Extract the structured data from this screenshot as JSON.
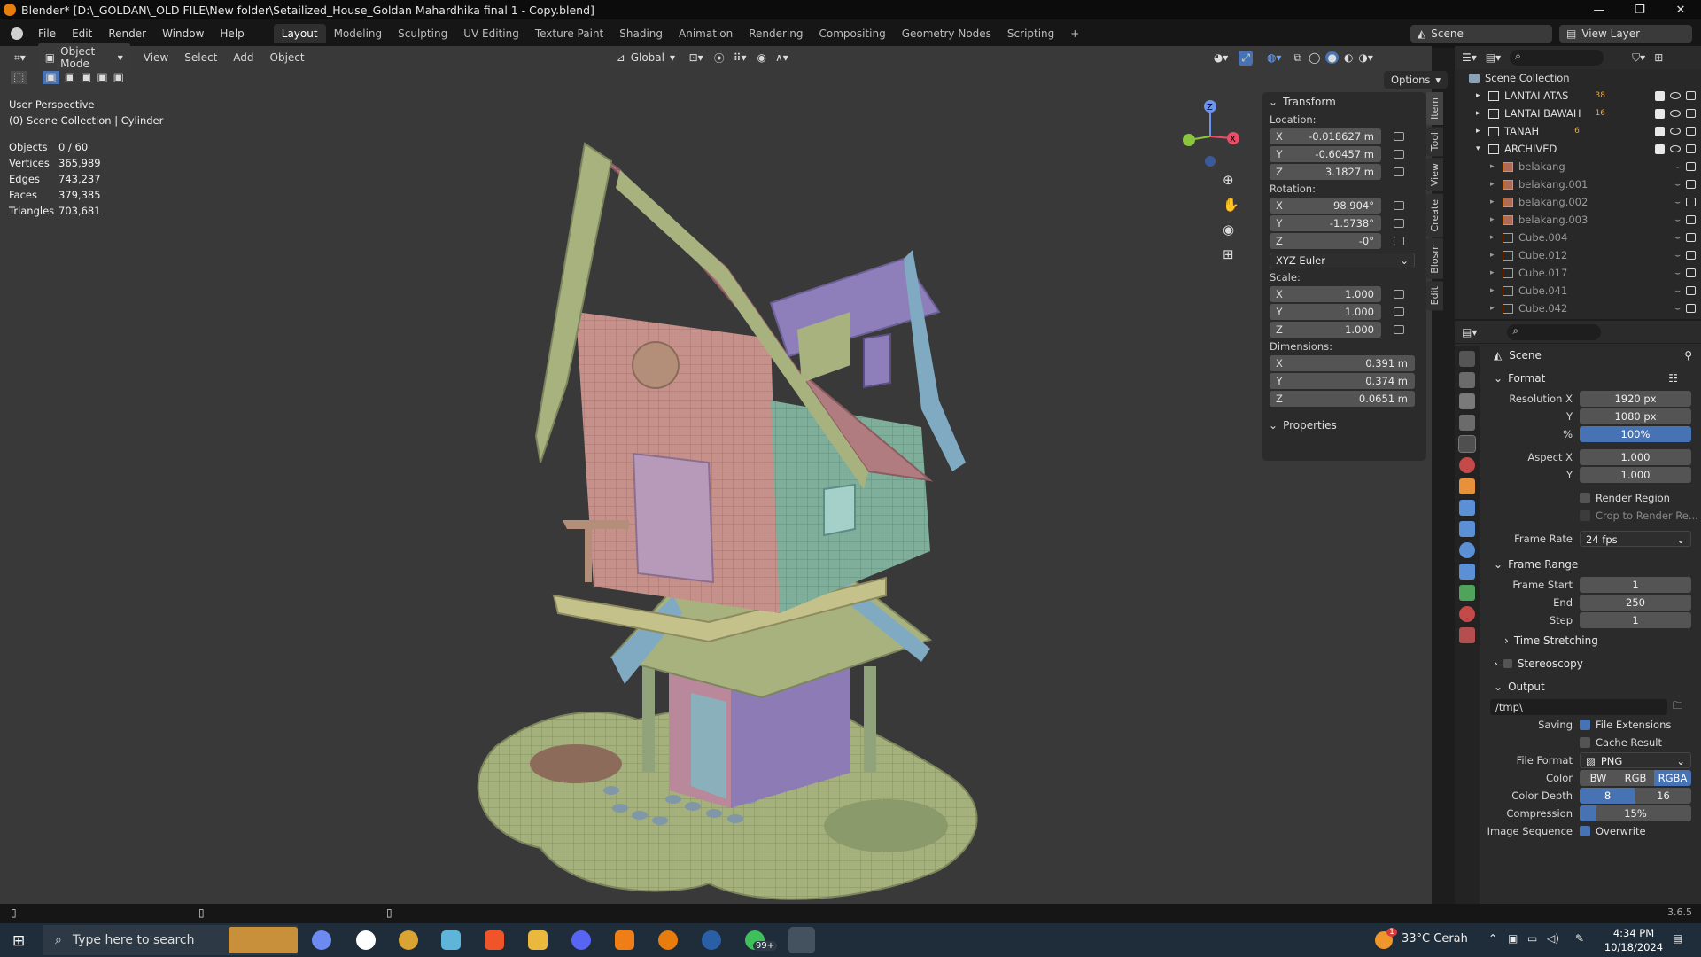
{
  "window": {
    "title": "Blender* [D:\\_GOLDAN\\_OLD FILE\\New folder\\Setailized_House_Goldan Mahardhika final 1 - Copy.blend]"
  },
  "menu": [
    "File",
    "Edit",
    "Render",
    "Window",
    "Help"
  ],
  "workspaces": [
    "Layout",
    "Modeling",
    "Sculpting",
    "UV Editing",
    "Texture Paint",
    "Shading",
    "Animation",
    "Rendering",
    "Compositing",
    "Geometry Nodes",
    "Scripting"
  ],
  "top_right": {
    "scene": "Scene",
    "view_layer": "View Layer"
  },
  "viewport_header": {
    "mode": "Object Mode",
    "menus": [
      "View",
      "Select",
      "Add",
      "Object"
    ],
    "orientation": "Global",
    "options": "Options"
  },
  "overlay": {
    "perspective": "User Perspective",
    "collection": "(0) Scene Collection | Cylinder",
    "stats": [
      {
        "label": "Objects",
        "value": "0 / 60"
      },
      {
        "label": "Vertices",
        "value": "365,989"
      },
      {
        "label": "Edges",
        "value": "743,237"
      },
      {
        "label": "Faces",
        "value": "379,385"
      },
      {
        "label": "Triangles",
        "value": "703,681"
      }
    ]
  },
  "gizmo": {
    "x": "X",
    "y": "Y",
    "z": "Z"
  },
  "npanel": {
    "transform": "Transform",
    "location_label": "Location:",
    "location": [
      "-0.018627 m",
      "-0.60457 m",
      "3.1827 m"
    ],
    "rotation_label": "Rotation:",
    "rotation": [
      "98.904°",
      "-1.5738°",
      "-0°"
    ],
    "rotation_mode": "XYZ Euler",
    "scale_label": "Scale:",
    "scale": [
      "1.000",
      "1.000",
      "1.000"
    ],
    "dimensions_label": "Dimensions:",
    "dimensions": [
      "0.391 m",
      "0.374 m",
      "0.0651 m"
    ],
    "properties": "Properties",
    "axes": [
      "X",
      "Y",
      "Z"
    ]
  },
  "vtabs": [
    "Item",
    "Tool",
    "View",
    "Create",
    "Blosm",
    "Edit"
  ],
  "outliner": {
    "root": "Scene Collection",
    "collections": [
      {
        "name": "LANTAI ATAS",
        "badge": "38"
      },
      {
        "name": "LANTAI BAWAH",
        "badge": "16"
      },
      {
        "name": "TANAH",
        "badge": "6"
      },
      {
        "name": "ARCHIVED",
        "badge": ""
      }
    ],
    "objects": [
      "belakang",
      "belakang.001",
      "belakang.002",
      "belakang.003",
      "Cube.004",
      "Cube.012",
      "Cube.017",
      "Cube.041",
      "Cube.042"
    ]
  },
  "properties": {
    "context": "Scene",
    "format": "Format",
    "res_x_label": "Resolution X",
    "res_x": "1920 px",
    "res_y_label": "Y",
    "res_y": "1080 px",
    "pct_label": "%",
    "pct": "100%",
    "aspect_x_label": "Aspect X",
    "aspect_x": "1.000",
    "aspect_y_label": "Y",
    "aspect_y": "1.000",
    "render_region": "Render Region",
    "crop": "Crop to Render Re...",
    "frame_rate_label": "Frame Rate",
    "frame_rate": "24 fps",
    "frame_range": "Frame Range",
    "start_label": "Frame Start",
    "start": "1",
    "end_label": "End",
    "end": "250",
    "step_label": "Step",
    "step": "1",
    "time_stretching": "Time Stretching",
    "stereoscopy": "Stereoscopy",
    "output": "Output",
    "path": "/tmp\\",
    "saving_label": "Saving",
    "file_ext": "File Extensions",
    "cache": "Cache Result",
    "file_format_label": "File Format",
    "file_format": "PNG",
    "color_label": "Color",
    "color_opts": [
      "BW",
      "RGB",
      "RGBA"
    ],
    "depth_label": "Color Depth",
    "depth_opts": [
      "8",
      "16"
    ],
    "compression_label": "Compression",
    "compression": "15%",
    "compression_level": 0.15,
    "image_seq_label": "Image Sequence",
    "overwrite": "Overwrite"
  },
  "status": {
    "version": "3.6.5"
  },
  "taskbar": {
    "search": "Type here to search",
    "weather": "33°C  Cerah",
    "time": "4:34 PM",
    "date": "10/18/2024",
    "badge": "99+",
    "notif": "1"
  }
}
